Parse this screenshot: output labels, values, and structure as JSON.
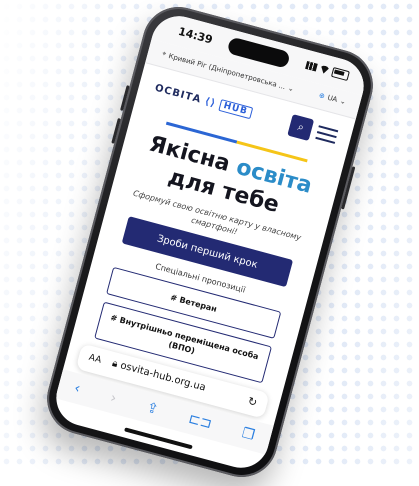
{
  "status": {
    "time": "14:39"
  },
  "browser": {
    "location": "Кривий Ріг (Дніпропетровська ...",
    "language": "UA",
    "url": "osvita-hub.org.ua",
    "aa_label": "AA"
  },
  "site": {
    "logo_text": "ОСВІТА",
    "logo_hub": "HUB",
    "headline_line1": "Якісна ",
    "headline_accent": "освіта",
    "headline_line2": "для тебе",
    "subtitle": "Сформуй свою освітню карту у власному смартфоні!",
    "cta_label": "Зроби перший крок",
    "special_label": "Спеціальні пропозиції",
    "tags": [
      "# Ветеран",
      "# Внутрішньо переміщена особа (ВПО)"
    ]
  },
  "colors": {
    "accent": "#232a73",
    "headline_accent": "#2b8cc8",
    "stripe_blue": "#2b66d4",
    "stripe_yellow": "#f5c518"
  }
}
